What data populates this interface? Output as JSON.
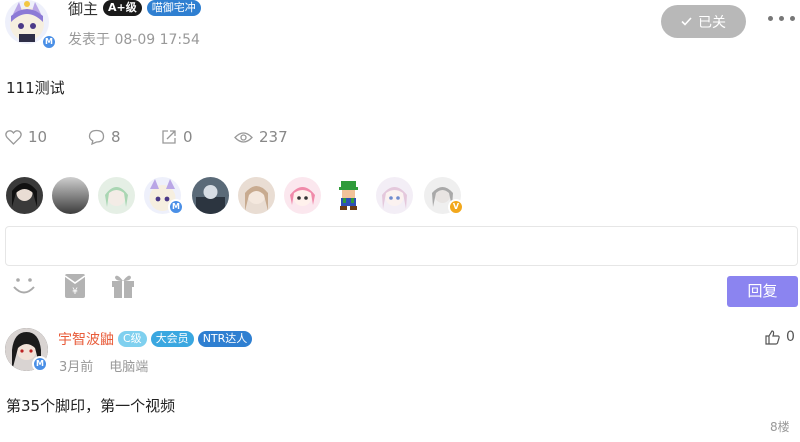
{
  "post": {
    "author": "御主",
    "level_tag": "A+级",
    "title_tag": "喵御宅冲",
    "verified_mark": "M",
    "time": "发表于 08-09 17:54",
    "status_button": "已关",
    "content": "111测试",
    "stats": {
      "likes": "10",
      "comments": "8",
      "shares": "0",
      "views": "237"
    },
    "viewer_count": 10,
    "viewer_badge": "V"
  },
  "reply": {
    "submit_label": "回复",
    "tools": [
      "emoji-icon",
      "red-envelope-icon",
      "gift-icon"
    ]
  },
  "comment": {
    "author": "宇智波鼬",
    "tags": [
      "C级",
      "大会员",
      "NTR达人"
    ],
    "verified_mark": "M",
    "time": "3月前",
    "device": "电脑端",
    "content": "第35个脚印，第一个视频",
    "likes": "0",
    "floor": "8楼"
  },
  "colors": {
    "accent_button": "#8b84f0",
    "closed_button": "#b8b8b8",
    "comment_name": "#e85c3a",
    "badge_blue": "#4a8fe6"
  }
}
